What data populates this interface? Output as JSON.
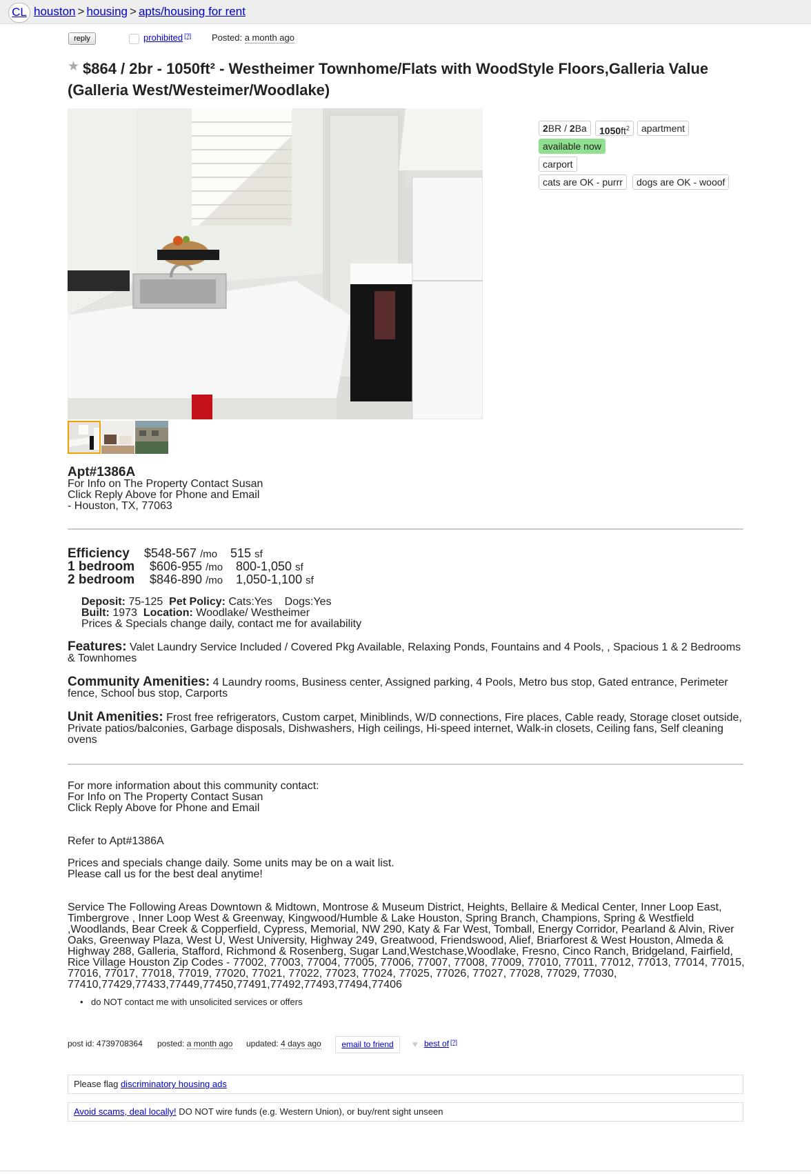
{
  "logo": "CL",
  "breadcrumbs": [
    "houston",
    "housing",
    "apts/housing for rent"
  ],
  "actions": {
    "reply": "reply",
    "prohibited": "prohibited",
    "help": "[?]",
    "posted_label": "Posted:",
    "posted_value": "a month ago"
  },
  "title": {
    "line1": "$864 / 2br - 1050ft² - Westheimer Townhome/Flats with WoodStyle Floors,Galleria Value",
    "line2": "(Galleria West/Westeimer/Woodlake)"
  },
  "attributes": {
    "br": "2",
    "br_label": "BR / ",
    "ba": "2",
    "ba_label": "Ba",
    "sqft": "1050",
    "sqft_unit": "ft",
    "sqft_sup": "2",
    "type": "apartment",
    "availability": "available now",
    "parking": "carport",
    "cats": "cats are OK - purrr",
    "dogs": "dogs are OK - wooof"
  },
  "body": {
    "apt": "Apt#1386A",
    "contact_line1": "For Info on The Property Contact Susan",
    "contact_line2": "Click Reply Above for Phone and Email",
    "location": "- Houston, TX, 77063"
  },
  "rates": [
    {
      "type": "Efficiency",
      "price": "$548-567",
      "per": "/mo",
      "size": "515",
      "unit": "sf"
    },
    {
      "type": "1 bedroom",
      "price": "$606-955",
      "per": "/mo",
      "size": "800-1,050",
      "unit": "sf"
    },
    {
      "type": "2 bedroom",
      "price": "$846-890",
      "per": "/mo",
      "size": "1,050-1,100",
      "unit": "sf"
    }
  ],
  "details": {
    "deposit_label": "Deposit:",
    "deposit": "75-125",
    "pet_label": "Pet Policy:",
    "pet": "Cats:Yes    Dogs:Yes",
    "built_label": "Built:",
    "built": "1973",
    "location_label": "Location:",
    "location": "Woodlake/ Westheimer",
    "note": "Prices & Specials change daily, contact me for availability"
  },
  "features": {
    "label": "Features:",
    "text": "Valet Laundry Service Included / Covered Pkg Available, Relaxing Ponds, Fountains and 4 Pools, , Spacious 1 & 2 Bedrooms & Townhomes"
  },
  "community": {
    "label": "Community Amenities:",
    "text": "4 Laundry rooms, Business center, Assigned parking, 4 Pools, Metro bus stop, Gated entrance, Perimeter fence, School bus stop, Carports"
  },
  "unit": {
    "label": "Unit Amenities:",
    "text": "Frost free refrigerators, Custom carpet, Miniblinds, W/D connections, Fire places, Cable ready, Storage closet outside, Private patios/balconies, Garbage disposals, Dishwashers, High ceilings, Hi-speed internet, Walk-in closets, Ceiling fans, Self cleaning ovens"
  },
  "more": {
    "line1": "For more information about this community contact:",
    "line2": "For Info on The Property Contact Susan",
    "line3": "Click Reply Above for Phone and Email",
    "refer": "Refer to Apt#1386A",
    "prices1": "Prices and specials change daily. Some units may be on a wait list.",
    "prices2": "Please call us for the best deal anytime!",
    "service": "Service The Following Areas Downtown & Midtown, Montrose & Museum District, Heights, Bellaire & Medical Center, Inner Loop East, Timbergrove , Inner Loop West & Greenway, Kingwood/Humble & Lake Houston, Spring Branch, Champions, Spring & Westfield ,Woodlands, Bear Creek & Copperfield, Cypress, Memorial, NW 290, Katy & Far West, Tomball, Energy Corridor, Pearland & Alvin, River Oaks, Greenway Plaza, West U, West University, Highway 249, Greatwood, Friendswood, Alief, Briarforest & West Houston, Almeda & Highway 288, Galleria, Stafford, Richmond & Rosenberg, Sugar Land,Westchase,Woodlake, Fresno, Cinco Ranch, Bridgeland, Fairfield, Rice Village Houston Zip Codes - 77002, 77003, 77004, 77005, 77006, 77007, 77008, 77009, 77010, 77011, 77012, 77013, 77014, 77015, 77016, 77017, 77018, 77019, 77020, 77021, 77022, 77023, 77024, 77025, 77026, 77027, 77028, 77029, 77030, 77410,77429,77433,77449,77450,77491,77492,77493,77494,77406"
  },
  "bullet": "do NOT contact me with unsolicited services or offers",
  "postinfo": {
    "id": "post id: 4739708364",
    "posted_label": "posted:",
    "posted": "a month ago",
    "updated_label": "updated:",
    "updated": "4 days ago",
    "email": "email to friend",
    "bestof": "best of",
    "help": "[?]"
  },
  "notices": {
    "flag_prefix": "Please flag",
    "flag_link": "discriminatory housing ads",
    "scam_link": "Avoid scams, deal locally!",
    "scam_text": "DO NOT wire funds (e.g. Western Union), or buy/rent sight unseen"
  },
  "colors": {
    "link": "#0000cc",
    "available_badge": "#90e090",
    "thumb_selected_border": "#f0a000"
  }
}
